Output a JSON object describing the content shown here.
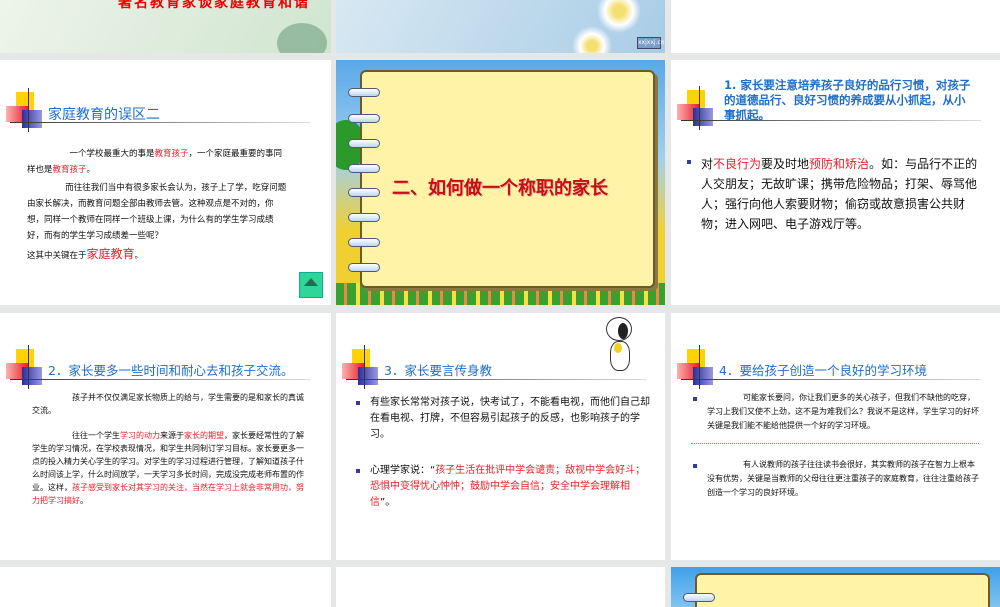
{
  "slides": [
    {
      "title": "著名教育家谈家庭教育和谐",
      "logo": "xxjxxj.cn"
    },
    {
      "header": "家庭教育的误区二",
      "p1": [
        "一个学校最重大的事是",
        "教育孩子",
        "，一个家庭最重要的事同样也是",
        "教育孩子",
        "。"
      ],
      "p2": "而往往我们当中有很多家长会认为，孩子上了学，吃穿问题由家长解决，而教育问题全部由教师去管。这种观点是不对的，你想，同样一个教师在同样一个班级上课，为什么有的学生学习成绩好，而有的学生学习成绩差一些呢？",
      "p3": [
        "这其中关键在于",
        "家庭教育",
        "。"
      ]
    },
    {
      "title": "二、如何做一个称职的家长"
    },
    {
      "header": "1. 家长要注意培养孩子良好的品行习惯，对孩子的道德品行、良好习惯的养成要从小抓起，从小事抓起。",
      "bullet": [
        "对",
        "不良行为",
        "要及时地",
        "预防和矫治",
        "。如：与品行不正的人交朋友；无故旷课；携带危险物品；打架、辱骂他人；强行向他人索要财物；偷窃或故意损害公共财物；进入网吧、电子游戏厅等。"
      ]
    },
    {
      "header": "2．家长要多一些时间和耐心去和孩子交流。",
      "p1": "孩子并不仅仅满足家长物质上的给与，学生需要的是和家长的真诚交流。",
      "p2": [
        "往往一个学生",
        "学习的动力",
        "来源于",
        "家长的期望",
        "，家长要经常性的了解学生的学习情况，在学校表现情况，和学生共同制订学习目标。家长要更多一点的投入精力关心学生的学习。对学生的学习过程进行管理，了解知道孩子什么时间该上学，什么时间放学，一天学习多长时间，完成没完成老师布置的作业。这样，",
        "孩子感受到家长对其学习的关注，当然在学习上就会非常用功，努力把学习搞好",
        "。"
      ]
    },
    {
      "header": "3．家长要言传身教",
      "b1": "有些家长常常对孩子说，快考试了，不能看电视，而他们自己却在看电视、打牌，不但容易引起孩子的反感，也影响孩子的学习。",
      "b2": [
        "心理学家说：“",
        "孩子生活在批评中学会谴责；敌视中学会好斗；恐惧中变得忧心忡忡；鼓励中学会自信；安全中学会理解相信",
        "”。"
      ]
    },
    {
      "header": "4．要给孩子创造一个良好的学习环境",
      "b1": "可能家长要问，你让我们更多的关心孩子，但我们不缺他的吃穿，学习上我们又使不上劲，这不是为难我们么？我说不是这样，学生学习的好坏关键是我们能不能给他提供一个好的学习环境。",
      "b2": "有人说教师的孩子往往读书会很好，其实教师的孩子在智力上根本没有优势，关键是当教师的父母往往更注重孩子的家庭教育，往往注重给孩子创造一个学习的良好环境。"
    }
  ]
}
